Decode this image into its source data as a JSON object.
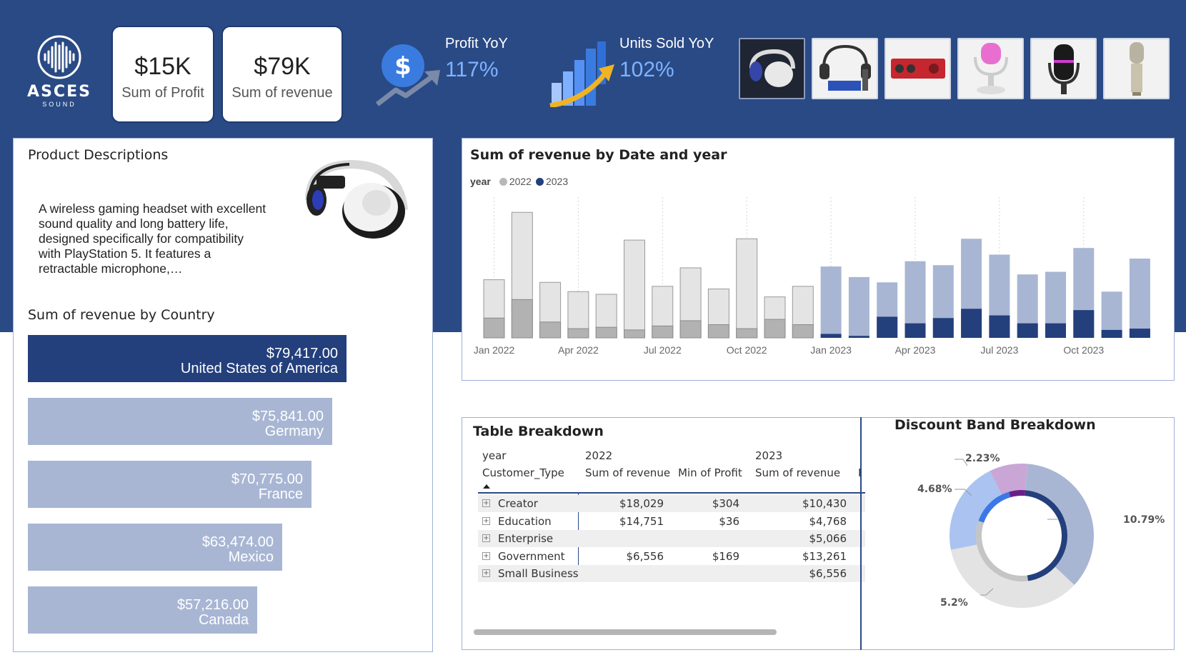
{
  "brand": {
    "name": "ASCES",
    "tagline": "SOUND"
  },
  "kpis": [
    {
      "value": "$15K",
      "label": "Sum of Profit"
    },
    {
      "value": "$79K",
      "label": "Sum of revenue"
    }
  ],
  "yoy": [
    {
      "title": "Profit YoY",
      "value": "117%"
    },
    {
      "title": "Units Sold YoY",
      "value": "102%"
    }
  ],
  "product_thumbnails": [
    "headset-icon",
    "studio-bundle-icon",
    "audio-interface-icon",
    "usb-microphone-icon",
    "podcast-microphone-icon",
    "condenser-microphone-icon"
  ],
  "product_panel": {
    "title": "Product Descriptions",
    "description": "A wireless gaming headset with excellent sound quality and long battery life, designed specifically for compatibility with PlayStation 5. It features a retractable microphone,…"
  },
  "country_chart": {
    "title": "Sum of revenue by Country",
    "selected_color": "#233f7c",
    "bar_color": "#a8b6d4",
    "items": [
      {
        "value": "$79,417.00",
        "country": "United States of America",
        "amount": 79417,
        "selected": true
      },
      {
        "value": "$75,841.00",
        "country": "Germany",
        "amount": 75841
      },
      {
        "value": "$70,775.00",
        "country": "France",
        "amount": 70775
      },
      {
        "value": "$63,474.00",
        "country": "Mexico",
        "amount": 63474
      },
      {
        "value": "$57,216.00",
        "country": "Canada",
        "amount": 57216
      }
    ]
  },
  "chart_data": {
    "type": "bar",
    "title": "Sum of revenue by Date and year",
    "legend_title": "year",
    "legend": [
      {
        "name": "2022",
        "color": "#b8b8b8"
      },
      {
        "name": "2023",
        "color": "#233f7c"
      }
    ],
    "tick_labels": [
      "Jan 2022",
      "Apr 2022",
      "Jul 2022",
      "Oct 2022",
      "Jan 2023",
      "Apr 2023",
      "Jul 2023",
      "Oct 2023"
    ],
    "series": [
      {
        "name": "2022",
        "total": [
          4.4,
          9.5,
          4.2,
          3.5,
          3.3,
          7.4,
          3.9,
          5.3,
          3.7,
          7.5,
          3.1,
          3.9
        ],
        "highlight": [
          1.5,
          2.9,
          1.2,
          0.7,
          0.8,
          0.6,
          0.9,
          1.3,
          1.0,
          0.7,
          1.4,
          1.0
        ]
      },
      {
        "name": "2023",
        "total": [
          5.4,
          4.6,
          4.2,
          5.8,
          5.5,
          7.5,
          6.3,
          4.8,
          5.0,
          6.8,
          3.5,
          6.0
        ],
        "highlight": [
          0.3,
          0.15,
          1.6,
          1.1,
          1.5,
          2.2,
          1.7,
          1.1,
          1.1,
          2.1,
          0.6,
          0.7
        ]
      }
    ],
    "ylim": [
      0,
      10
    ]
  },
  "table": {
    "title": "Table Breakdown",
    "header_year_label": "year",
    "header_row_label": "Customer_Type",
    "year_2022": "2022",
    "year_2023": "2023",
    "col_revenue": "Sum of revenue",
    "col_profit": "Min of Profit",
    "col_trunc": "I",
    "rows": [
      {
        "type": "Creator",
        "rev2022": "$18,029",
        "profit2022": "$304",
        "rev2023": "$10,430"
      },
      {
        "type": "Education",
        "rev2022": "$14,751",
        "profit2022": "$36",
        "rev2023": "$4,768"
      },
      {
        "type": "Enterprise",
        "rev2022": "",
        "profit2022": "",
        "rev2023": "$5,066"
      },
      {
        "type": "Government",
        "rev2022": "$6,556",
        "profit2022": "$169",
        "rev2023": "$13,261"
      },
      {
        "type": "Small Business",
        "rev2022": "",
        "profit2022": "",
        "rev2023": "$6,556"
      }
    ]
  },
  "donut": {
    "title": "Discount Band Breakdown",
    "labels": [
      "10.79%",
      "5.2%",
      "4.68%",
      "2.23%"
    ],
    "outer_percents": [
      35.7,
      34.9,
      20.9,
      8.5
    ],
    "inner_percents": [
      46.5,
      32.5,
      15.2,
      5.8
    ],
    "outer_colors": [
      "#a8b6d4",
      "#e3e3e3",
      "#aac3f0",
      "#c9a6d6"
    ],
    "inner_colors": [
      "#233f7c",
      "#c5c5c5",
      "#3b77e8",
      "#6a1f86"
    ]
  }
}
